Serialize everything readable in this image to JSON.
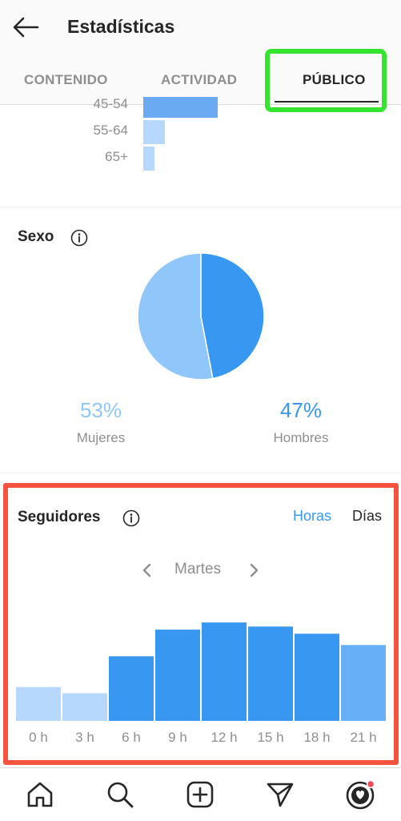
{
  "header": {
    "title": "Estadísticas",
    "back_icon": "arrow-left-icon"
  },
  "tabs": [
    {
      "label": "CONTENIDO",
      "active": false
    },
    {
      "label": "ACTIVIDAD",
      "active": false
    },
    {
      "label": "PÚBLICO",
      "active": true
    }
  ],
  "age_ranges": {
    "items": [
      {
        "label": "45-54",
        "share": 0.58
      },
      {
        "label": "55-64",
        "share": 0.17
      },
      {
        "label": "65+",
        "share": 0.09
      }
    ]
  },
  "gender": {
    "title": "Sexo",
    "female": {
      "percent": "53%",
      "label": "Mujeres",
      "value": 53,
      "color": "#90c7fb"
    },
    "male": {
      "percent": "47%",
      "label": "Hombres",
      "value": 47,
      "color": "#3897f0"
    }
  },
  "followers": {
    "title": "Seguidores",
    "toggle_hours": "Horas",
    "toggle_days": "Días",
    "day": "Martes",
    "accent": "#3897f0"
  },
  "chart_data": {
    "type": "bar",
    "categories": [
      "0 h",
      "3 h",
      "6 h",
      "9 h",
      "12 h",
      "15 h",
      "18 h",
      "21 h"
    ],
    "values": [
      33,
      27,
      63,
      89,
      96,
      92,
      85,
      74
    ],
    "ylim": [
      0,
      100
    ],
    "grid": false,
    "colors": [
      "#b5d8fc",
      "#b5d8fc",
      "#3897f0",
      "#3897f0",
      "#3897f0",
      "#3897f0",
      "#3897f0",
      "#67b0f8"
    ]
  },
  "bottom_nav": [
    "home-icon",
    "search-icon",
    "new-post-icon",
    "direct-icon",
    "profile-icon"
  ],
  "colors": {
    "highlight_green": "#33e52e",
    "highlight_red": "#f4533d"
  }
}
